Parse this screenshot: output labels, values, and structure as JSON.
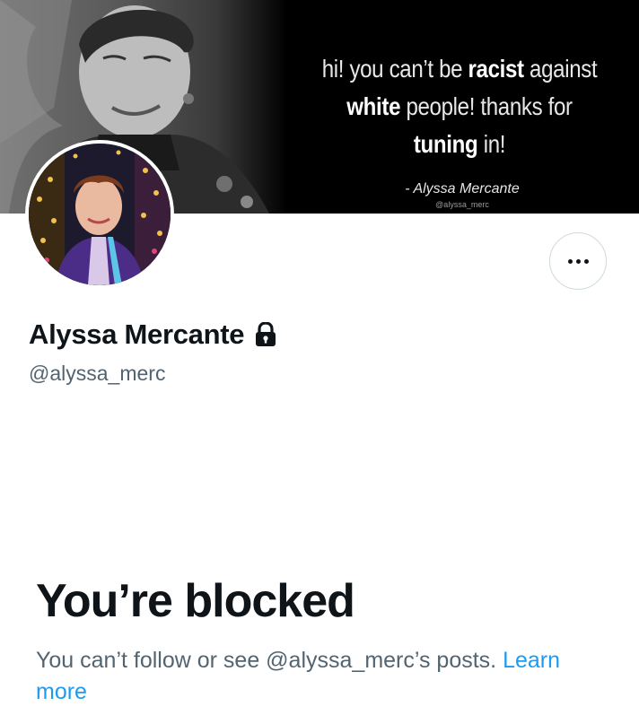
{
  "banner": {
    "quote_prefix": "hi! you can’t be ",
    "quote_bold1": "racist",
    "quote_mid1": " against",
    "quote_bold2": "white",
    "quote_mid2": " people! thanks for",
    "quote_bold3": "tuning",
    "quote_suffix": " in!",
    "quote_author": "- Alyssa Mercante",
    "quote_handle": "@alyssa_merc"
  },
  "profile": {
    "display_name": "Alyssa Mercante",
    "handle": "@alyssa_merc",
    "protected_icon": "lock-icon",
    "more_icon": "more-dots-icon"
  },
  "blocked": {
    "title": "You’re blocked",
    "description": "You can’t follow or see @alyssa_merc’s posts. ",
    "link_label": "Learn more"
  },
  "colors": {
    "text_primary": "#0f1419",
    "text_secondary": "#536471",
    "link": "#1d9bf0",
    "border": "#cfd9de"
  }
}
